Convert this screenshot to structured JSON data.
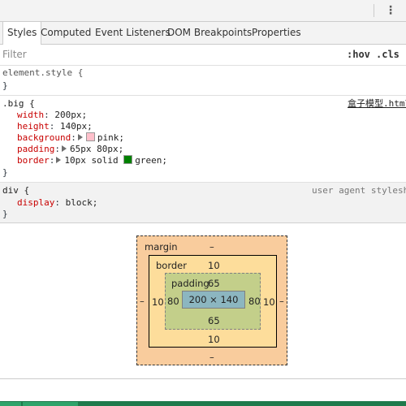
{
  "window": {
    "menu_icon": "kebab-menu-icon",
    "menu_glyph": "⋮"
  },
  "tabs": [
    {
      "label": "Styles",
      "active": true
    },
    {
      "label": "Computed"
    },
    {
      "label": "Event Listeners"
    },
    {
      "label": "DOM Breakpoints"
    },
    {
      "label": "Properties"
    }
  ],
  "filter": {
    "placeholder": "Filter",
    "hov": ":hov",
    "cls": ".cls"
  },
  "rules": {
    "element_style": {
      "selector": "element.style {",
      "close": "}"
    },
    "big": {
      "selector": ".big {",
      "source": "盒子模型.html",
      "props": [
        {
          "name": "width",
          "value": "200px;"
        },
        {
          "name": "height",
          "value": "140px;"
        },
        {
          "name": "background",
          "value": "pink;",
          "swatch": "#ffc0cb"
        },
        {
          "name": "padding",
          "value": "65px 80px;"
        },
        {
          "name": "border",
          "value": "10px solid ",
          "swatch": "#008000",
          "value2": "green;"
        }
      ],
      "close": "}"
    },
    "div": {
      "selector": "div {",
      "source": "user agent stylesheet",
      "props": [
        {
          "name": "display",
          "value": "block;"
        }
      ],
      "close": "}"
    }
  },
  "box_model": {
    "margin_label": "margin",
    "margin_top": "–",
    "margin_bottom": "–",
    "margin_left": "–",
    "margin_right": "–",
    "border_label": "border",
    "border_top": "10",
    "border_bottom": "10",
    "border_left": "10",
    "border_right": "10",
    "padding_label": "padding",
    "padding_top": "65",
    "padding_bottom": "65",
    "padding_left": "80",
    "padding_right": "80",
    "content": "200 × 140",
    "colors": {
      "margin": "#f9cc9d",
      "border": "#fddd9b",
      "padding": "#c3cf8a",
      "content": "#8cb6c0"
    }
  }
}
